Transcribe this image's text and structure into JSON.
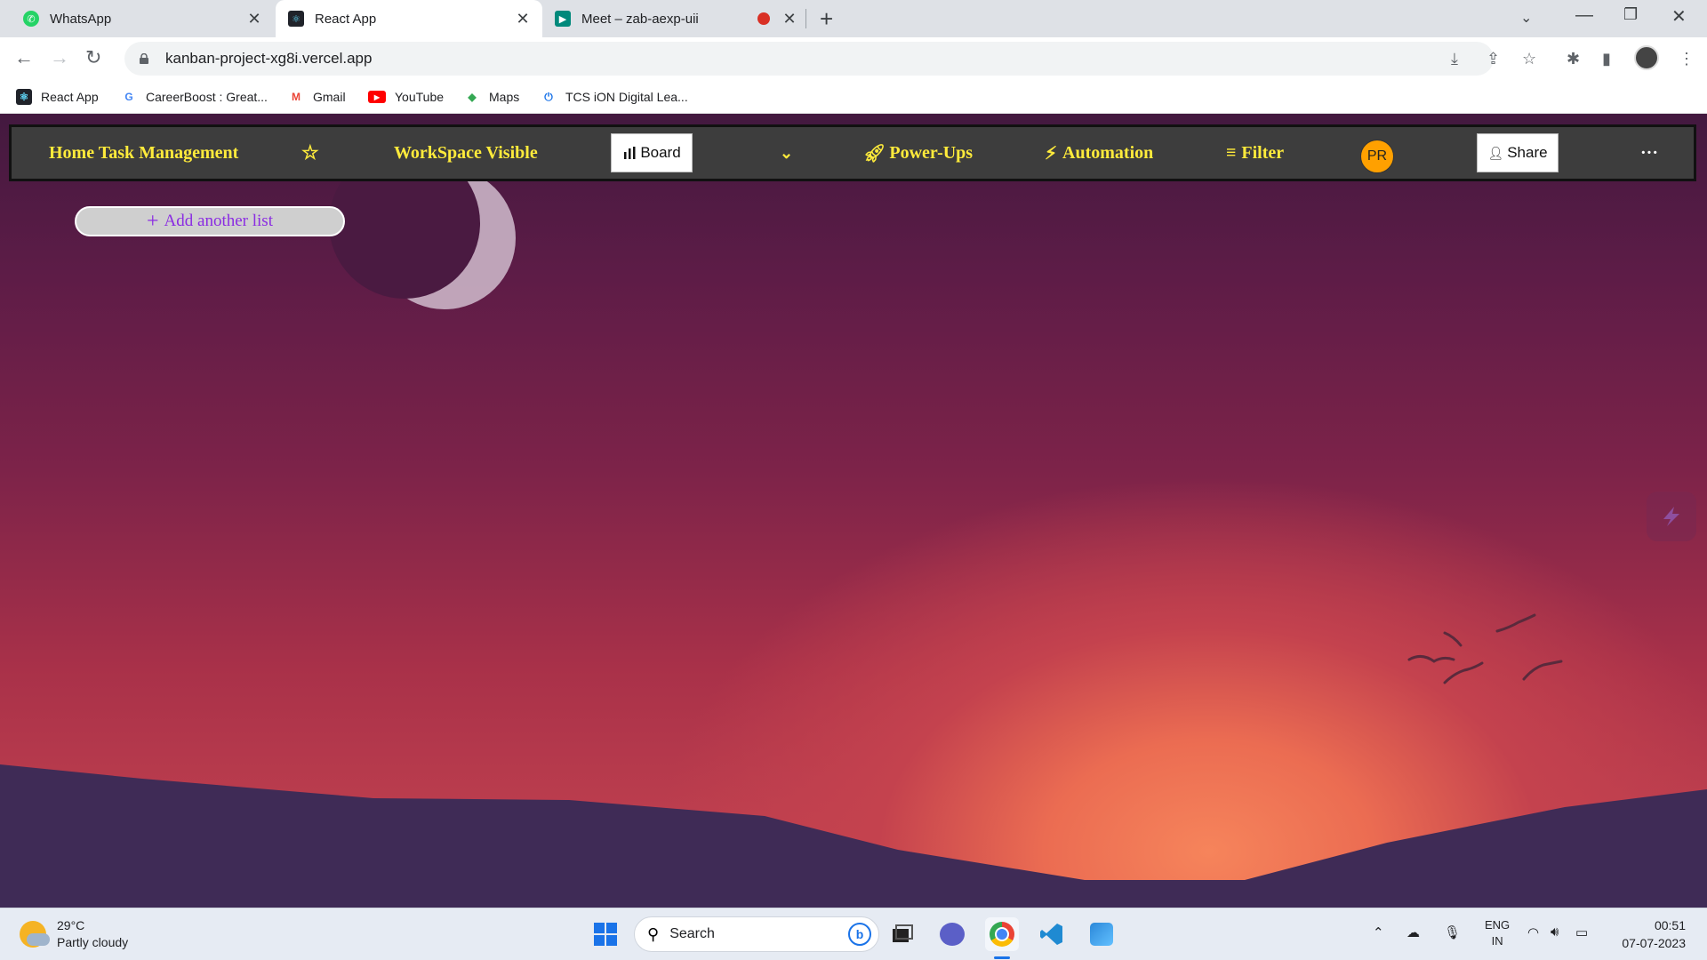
{
  "browser": {
    "tabs": [
      {
        "title": "WhatsApp",
        "active": false
      },
      {
        "title": "React App",
        "active": true
      },
      {
        "title": "Meet – zab-aexp-uii",
        "active": false
      }
    ],
    "url": "kanban-project-xg8i.vercel.app",
    "bookmarks": [
      "React App",
      "CareerBoost : Great...",
      "Gmail",
      "YouTube",
      "Maps",
      "TCS iON Digital Lea..."
    ]
  },
  "navbar": {
    "title": "Home Task Management",
    "workspace": "WorkSpace Visible",
    "board": "Board",
    "power_ups": "Power-Ups",
    "automation": "Automation",
    "filter": "Filter",
    "avatar": "PR",
    "share": "Share",
    "more": "···"
  },
  "board": {
    "add_list": "Add another list"
  },
  "taskbar": {
    "weather_temp": "29°C",
    "weather_desc": "Partly cloudy",
    "search": "Search",
    "lang1": "ENG",
    "lang2": "IN",
    "time": "00:51",
    "date": "07-07-2023"
  },
  "colors": {
    "nav_text": "#ffeb3b",
    "nav_bg": "#3d3d3d",
    "add_list_text": "#8a2be2",
    "avatar_bg": "#ffa000"
  }
}
